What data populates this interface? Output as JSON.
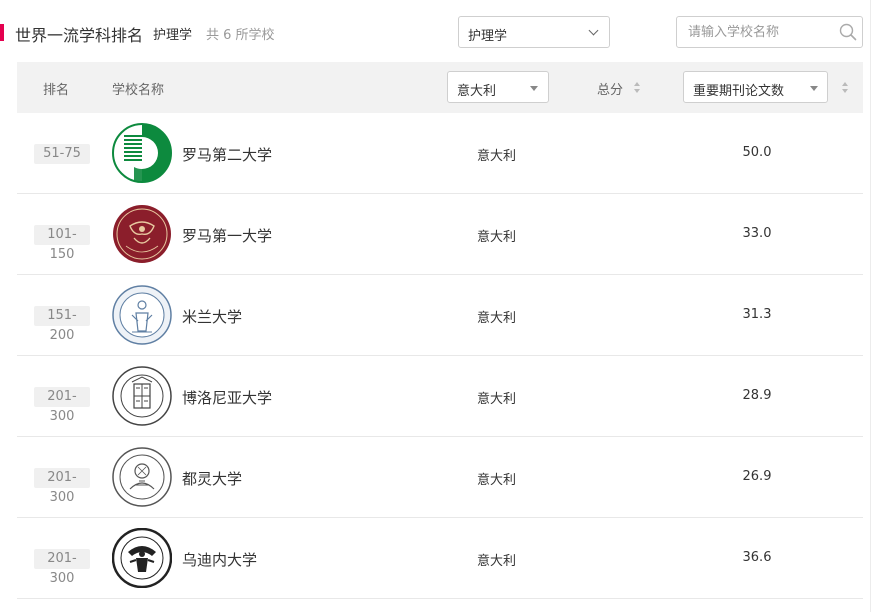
{
  "header": {
    "title": "世界一流学科排名",
    "subject": "护理学",
    "count_text": "共 6 所学校",
    "accent_color": "#e4004f"
  },
  "subject_select": {
    "value": "护理学",
    "icon": "chevron-down-icon"
  },
  "search": {
    "placeholder": "请输入学校名称",
    "icon": "search-icon"
  },
  "table": {
    "columns": {
      "rank": "排名",
      "name": "学校名称",
      "country_filter": "意大利",
      "total": "总分",
      "metric": "重要期刊论文数"
    },
    "rows": [
      {
        "rank": "51-75",
        "name": "罗马第二大学",
        "country": "意大利",
        "score": "50.0",
        "logo": "tor-vergata-logo",
        "logo_color": "#0d8a3e"
      },
      {
        "rank": "101-150",
        "name": "罗马第一大学",
        "country": "意大利",
        "score": "33.0",
        "logo": "sapienza-seal",
        "logo_color": "#8b1e2b"
      },
      {
        "rank": "151-200",
        "name": "米兰大学",
        "country": "意大利",
        "score": "31.3",
        "logo": "milan-seal",
        "logo_color": "#5f7fa3"
      },
      {
        "rank": "201-300",
        "name": "博洛尼亚大学",
        "country": "意大利",
        "score": "28.9",
        "logo": "bologna-seal",
        "logo_color": "#444444"
      },
      {
        "rank": "201-300",
        "name": "都灵大学",
        "country": "意大利",
        "score": "26.9",
        "logo": "turin-seal",
        "logo_color": "#555555"
      },
      {
        "rank": "201-300",
        "name": "乌迪内大学",
        "country": "意大利",
        "score": "36.6",
        "logo": "udine-seal",
        "logo_color": "#222222"
      }
    ]
  }
}
